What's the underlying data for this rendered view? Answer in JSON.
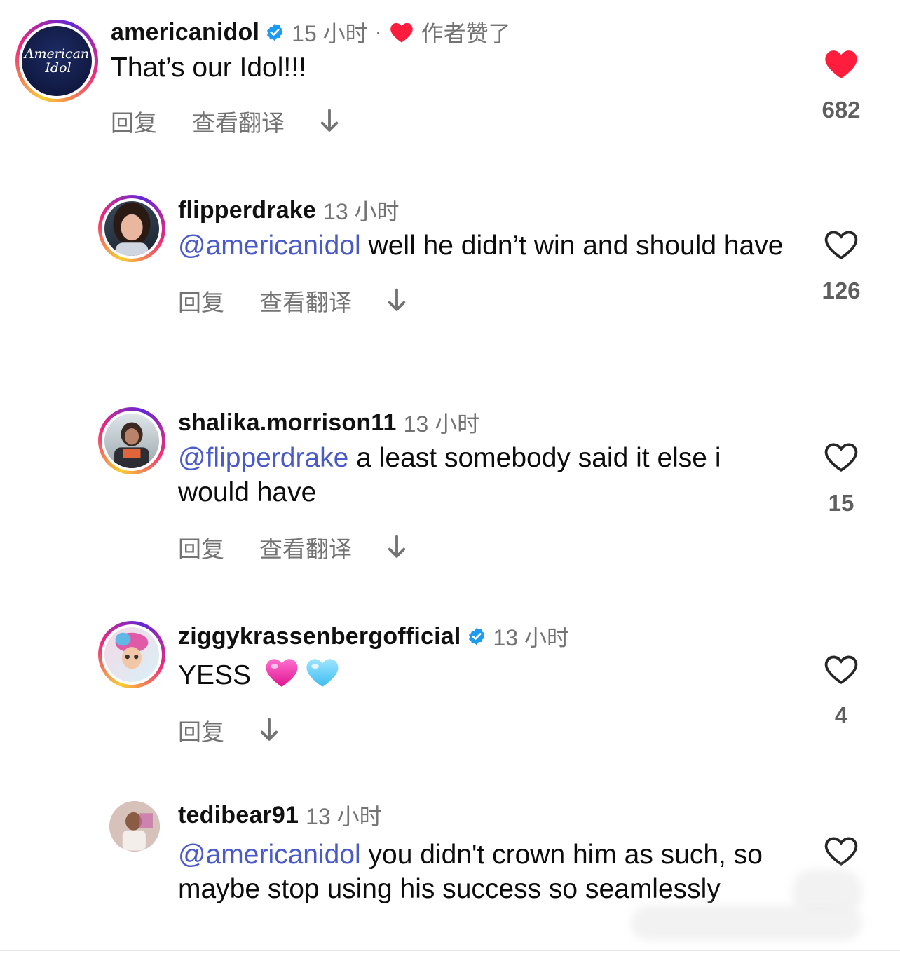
{
  "comments": [
    {
      "username": "americanidol",
      "verified": true,
      "time": "15 小时",
      "separator": "·",
      "author_liked": "作者赞了",
      "text_mention": "",
      "text": "That’s our Idol!!!",
      "actions": {
        "reply": "回复",
        "translate": "查看翻译"
      },
      "liked": true,
      "like_count": "682",
      "avatar_text": "American Idol"
    },
    {
      "username": "flipperdrake",
      "verified": false,
      "time": "13 小时",
      "text_mention": "@americanidol",
      "text": " well he didn’t win and should have",
      "actions": {
        "reply": "回复",
        "translate": "查看翻译"
      },
      "liked": false,
      "like_count": "126"
    },
    {
      "username": "shalika.morrison11",
      "verified": false,
      "time": "13 小时",
      "text_mention": "@flipperdrake",
      "text": " a least somebody said it else i would have",
      "actions": {
        "reply": "回复",
        "translate": "查看翻译"
      },
      "liked": false,
      "like_count": "15"
    },
    {
      "username": "ziggykrassenbergofficial",
      "verified": true,
      "time": "13 小时",
      "text_mention": "",
      "text": "YESS ",
      "emojis": [
        "pink-heart-emoji",
        "light-blue-heart-emoji"
      ],
      "actions": {
        "reply": "回复"
      },
      "liked": false,
      "like_count": "4"
    },
    {
      "username": "tedibear91",
      "verified": false,
      "time": "13 小时",
      "text_mention": "@americanidol",
      "text": " you didn't crown him as such, so maybe stop using his success so seamlessly",
      "liked": false
    }
  ],
  "colors": {
    "mention": "#4a5bc7",
    "like_red": "#ff1d3d",
    "verified_blue": "#1d9bf0",
    "meta_gray": "#737373"
  }
}
